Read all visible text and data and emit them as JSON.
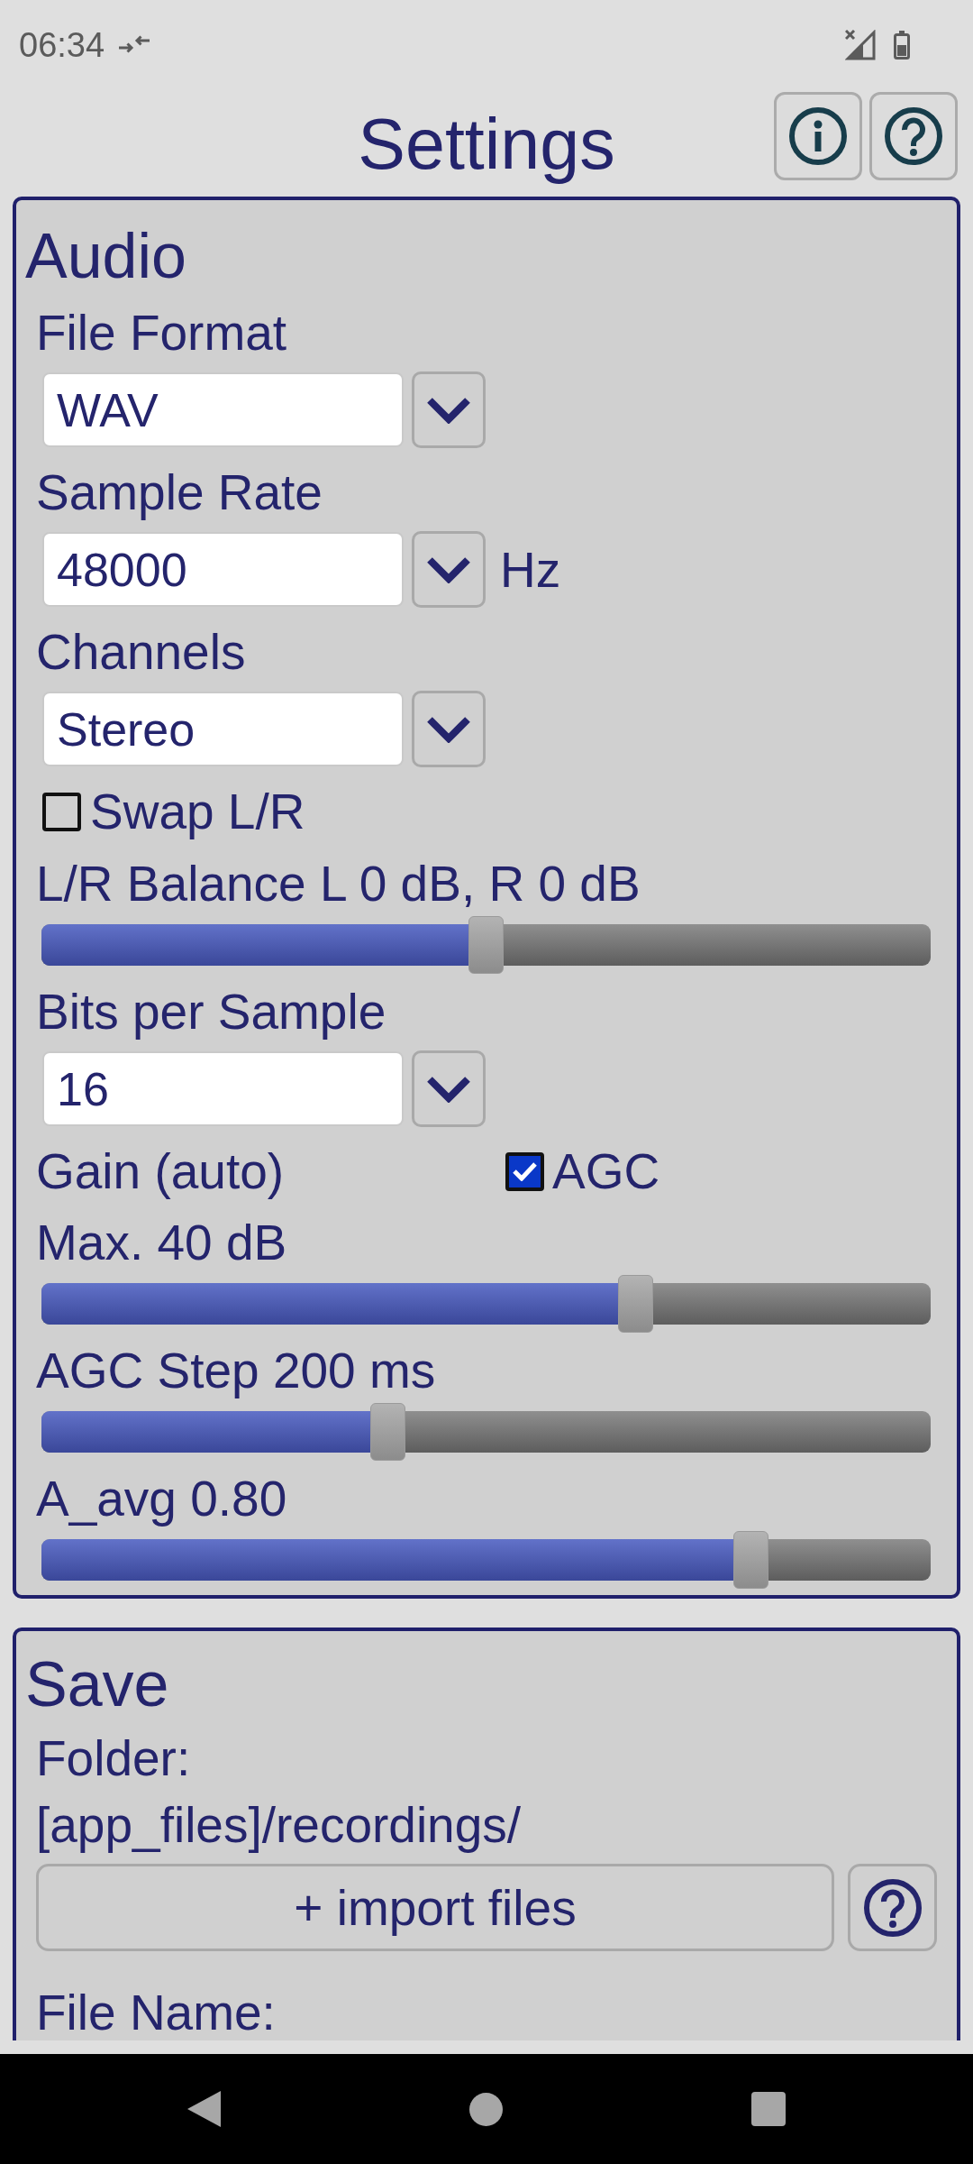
{
  "status_bar": {
    "time": "06:34"
  },
  "header": {
    "title": "Settings"
  },
  "audio": {
    "heading": "Audio",
    "items": [
      {
        "kind": "dropdown",
        "label": "File Format",
        "value": "WAV"
      },
      {
        "kind": "dropdown",
        "label": "Sample Rate",
        "value": "48000",
        "unit": "Hz"
      },
      {
        "kind": "dropdown",
        "label": "Channels",
        "value": "Stereo"
      },
      {
        "kind": "checkbox",
        "label": "Swap L/R",
        "checked": false
      },
      {
        "kind": "slider",
        "label": "L/R Balance L 0 dB, R 0 dB",
        "level": 0.5
      },
      {
        "kind": "dropdown",
        "label": "Bits per Sample",
        "value": "16"
      },
      {
        "kind": "label_checkbox",
        "label": "Gain (auto)",
        "option": "AGC",
        "checked": true
      },
      {
        "kind": "slider",
        "label": "Max. 40 dB",
        "level": 0.675
      },
      {
        "kind": "slider",
        "label": "AGC Step 200 ms",
        "level": 0.385
      },
      {
        "kind": "slider",
        "label": "A_avg 0.80",
        "level": 0.81
      }
    ]
  },
  "save": {
    "heading": "Save",
    "items": [
      {
        "kind": "text",
        "text": "Folder:"
      },
      {
        "kind": "text",
        "text": "[app_files]/recordings/"
      },
      {
        "kind": "button",
        "label": "+ import files"
      },
      {
        "kind": "text",
        "text": "File Name:"
      }
    ]
  }
}
